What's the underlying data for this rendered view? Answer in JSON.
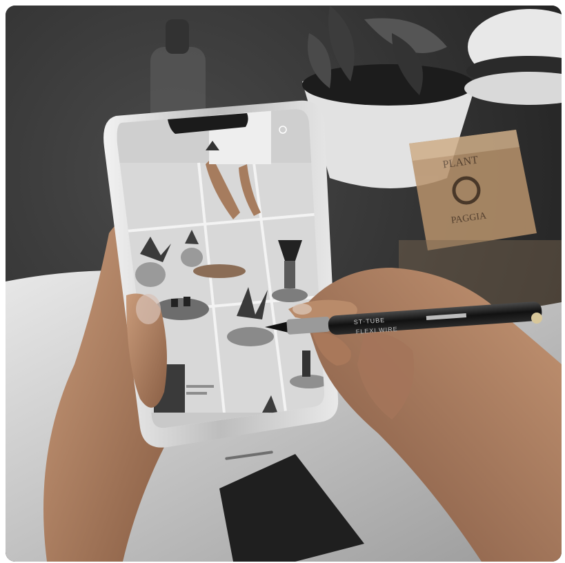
{
  "photo": {
    "subject": "hands-holding-smartphone-with-stylus",
    "colors": {
      "background_dark": "#2a2a2a",
      "blanket": "#cfcfcf",
      "skin": "#b98b6a",
      "phone_frame": "#d9d9d9",
      "screen_bg": "#e6e6e6",
      "box_kraft": "#b8936c",
      "pen_body": "#1a1a1a"
    }
  },
  "box_label": {
    "line1": "PLANT",
    "line2": "PAGGIA"
  },
  "pen_label": {
    "brand": "ST·TUBE",
    "model": "FLEXI WIRE"
  },
  "screen_card_text": {
    "line1": "",
    "line2": ""
  }
}
